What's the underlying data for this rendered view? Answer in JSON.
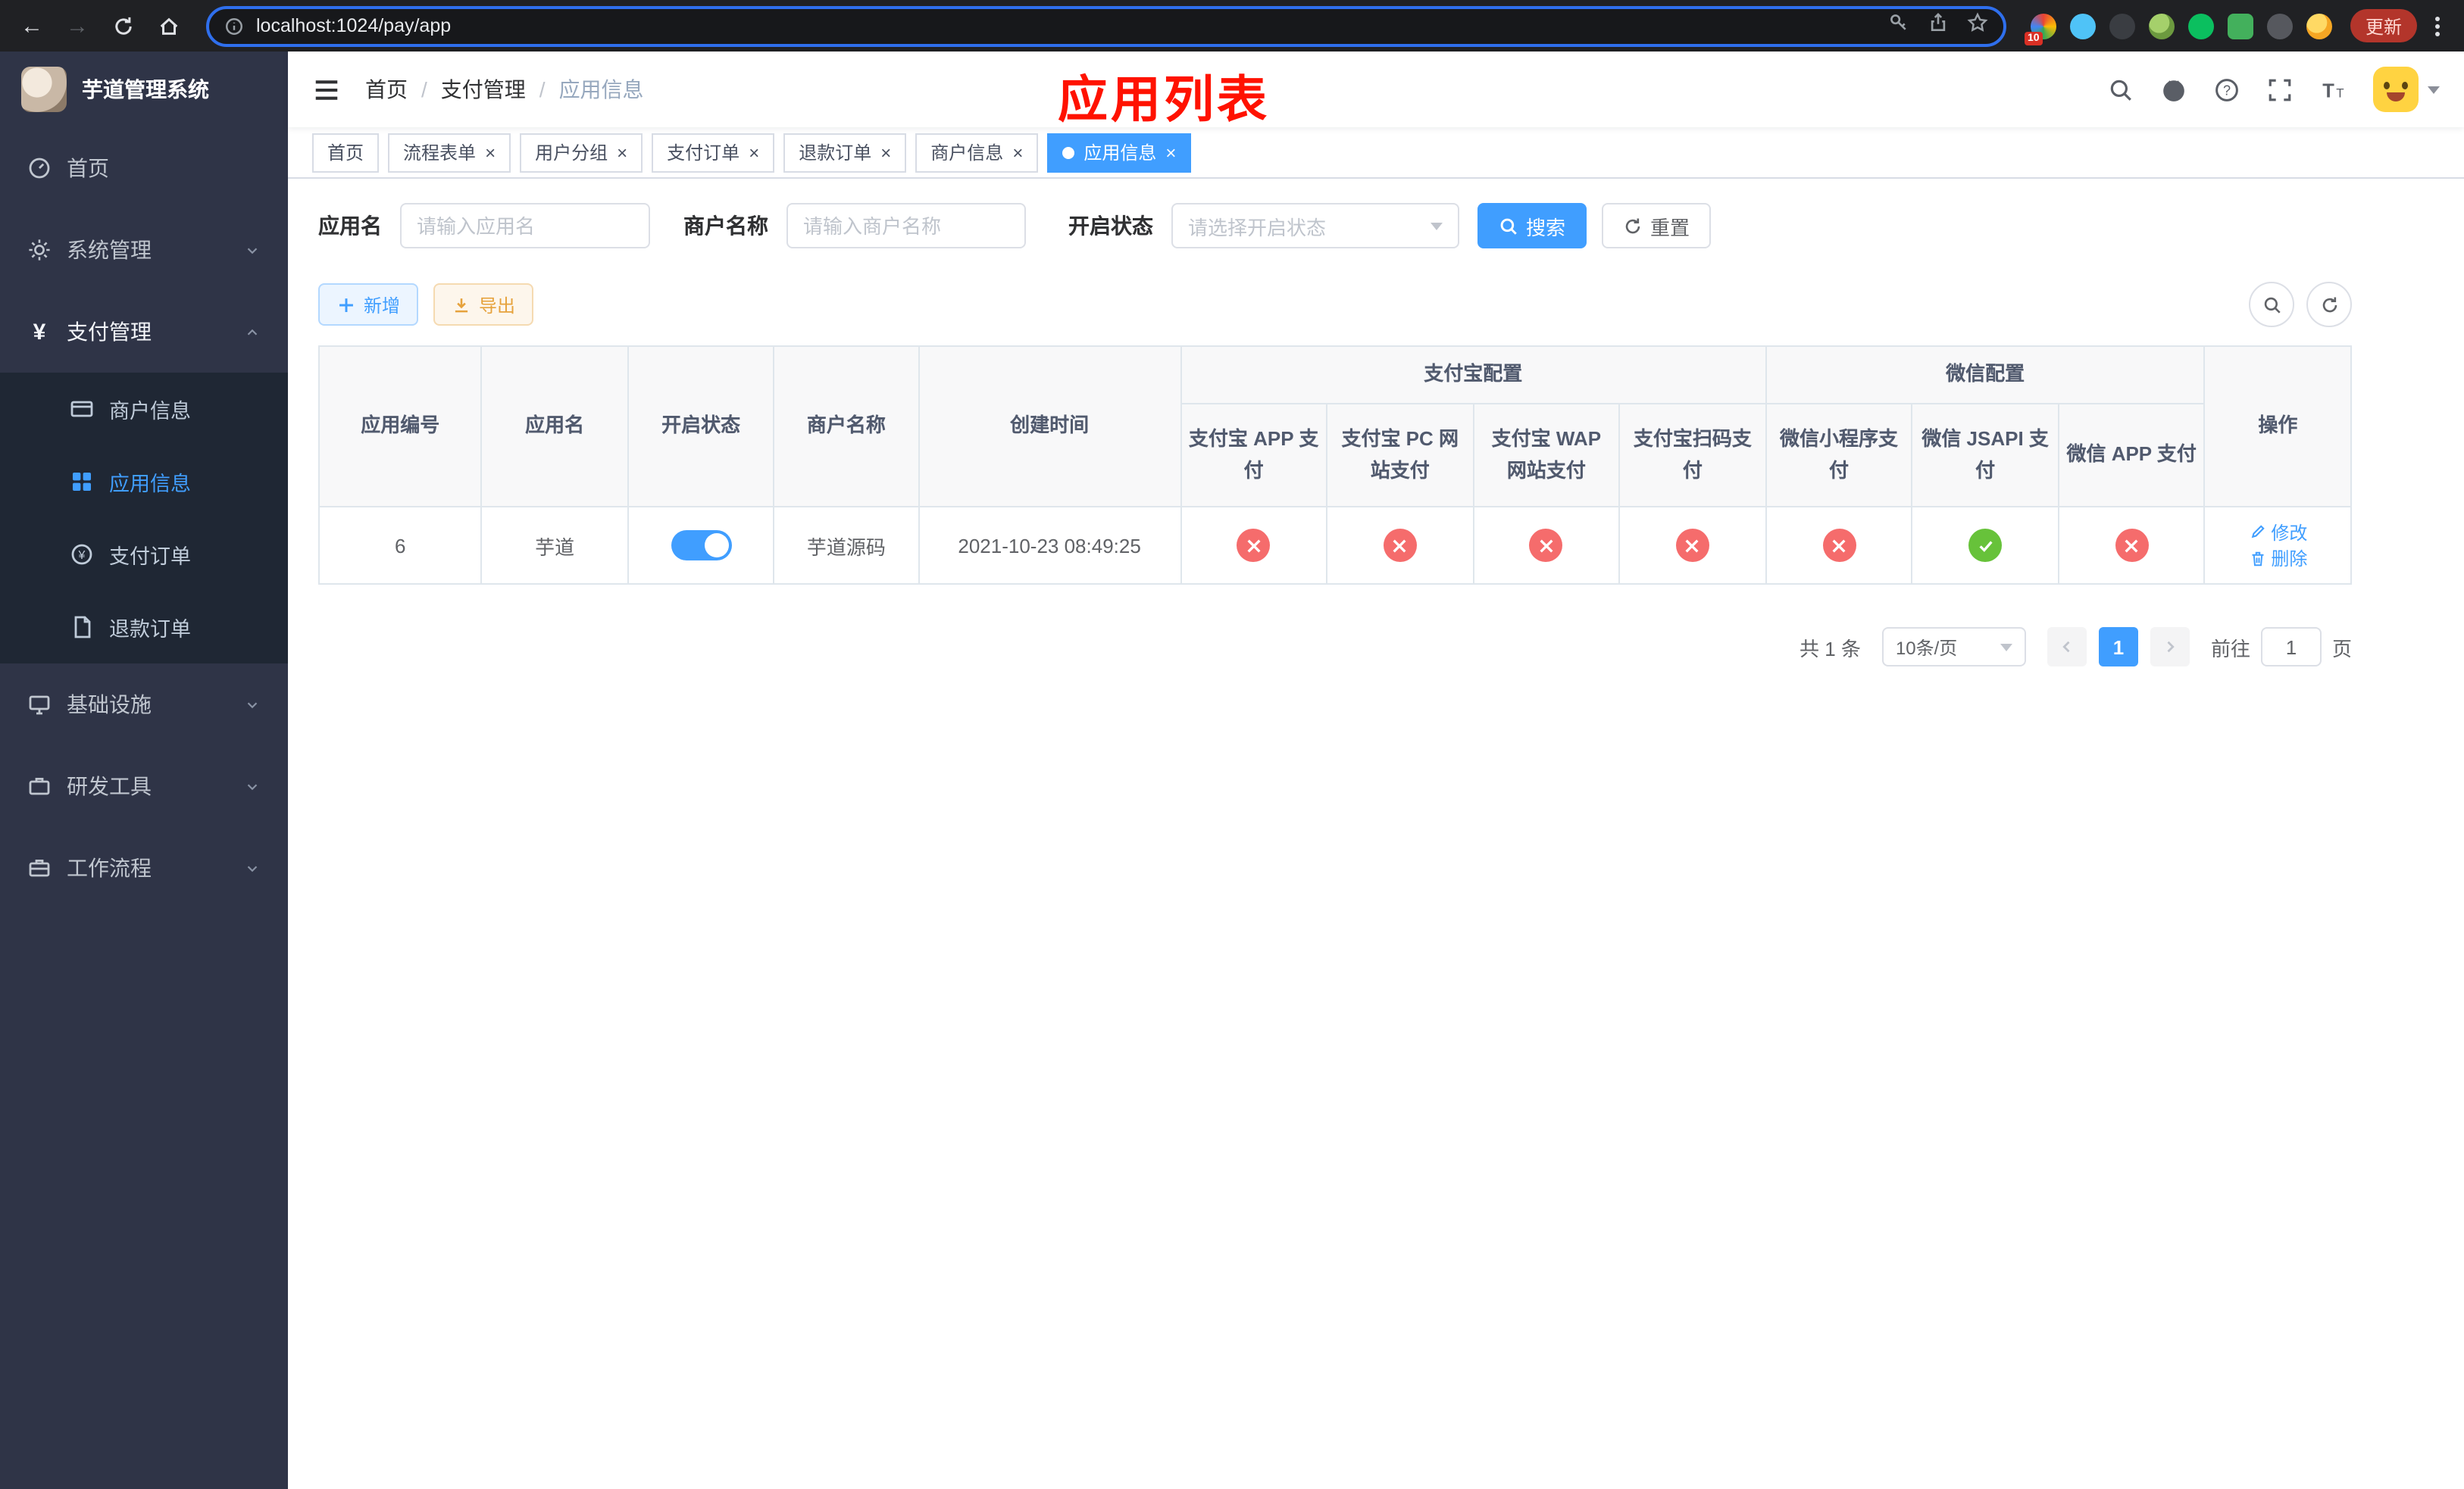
{
  "theme": {
    "primary": "#409eff",
    "success": "#67c23a",
    "danger": "#f56c6c",
    "warning": "#e6a23c",
    "sidebar_bg": "#2f3447",
    "annotation_red": "#ff1200"
  },
  "browser": {
    "url": "localhost:1024/pay/app",
    "update_label": "更新",
    "extension_badge": "10"
  },
  "sidebar": {
    "title": "芋道管理系统",
    "items": [
      {
        "label": "首页"
      },
      {
        "label": "系统管理"
      },
      {
        "label": "支付管理"
      },
      {
        "label": "基础设施"
      },
      {
        "label": "研发工具"
      },
      {
        "label": "工作流程"
      }
    ],
    "payment_children": [
      {
        "label": "商户信息"
      },
      {
        "label": "应用信息",
        "active": true
      },
      {
        "label": "支付订单"
      },
      {
        "label": "退款订单"
      }
    ]
  },
  "header": {
    "breadcrumb": [
      "首页",
      "支付管理",
      "应用信息"
    ],
    "annotation": "应用列表"
  },
  "tabs": [
    {
      "label": "首页",
      "closable": false,
      "active": false
    },
    {
      "label": "流程表单",
      "closable": true,
      "active": false
    },
    {
      "label": "用户分组",
      "closable": true,
      "active": false
    },
    {
      "label": "支付订单",
      "closable": true,
      "active": false
    },
    {
      "label": "退款订单",
      "closable": true,
      "active": false
    },
    {
      "label": "商户信息",
      "closable": true,
      "active": false
    },
    {
      "label": "应用信息",
      "closable": true,
      "active": true
    }
  ],
  "filters": {
    "app_name_label": "应用名",
    "app_name_placeholder": "请输入应用名",
    "app_name_value": "",
    "merchant_label": "商户名称",
    "merchant_placeholder": "请输入商户名称",
    "merchant_value": "",
    "status_label": "开启状态",
    "status_placeholder": "请选择开启状态",
    "search_label": "搜索",
    "reset_label": "重置"
  },
  "toolbar": {
    "add_label": "新增",
    "export_label": "导出"
  },
  "table": {
    "group_headers": {
      "alipay": "支付宝配置",
      "wechat": "微信配置"
    },
    "columns": [
      "应用编号",
      "应用名",
      "开启状态",
      "商户名称",
      "创建时间",
      "支付宝 APP 支付",
      "支付宝 PC 网站支付",
      "支付宝 WAP 网站支付",
      "支付宝扫码支付",
      "微信小程序支付",
      "微信 JSAPI 支付",
      "微信 APP 支付",
      "操作"
    ],
    "row": {
      "app_id": "6",
      "app_name": "芋道",
      "status_on": true,
      "merchant_name": "芋道源码",
      "created_at": "2021-10-23 08:49:25",
      "configs": [
        "x",
        "x",
        "x",
        "x",
        "x",
        "check",
        "x"
      ],
      "edit_label": "修改",
      "delete_label": "删除"
    }
  },
  "pagination": {
    "total_text": "共 1 条",
    "page_size": "10条/页",
    "current_page": "1",
    "goto_label": "前往",
    "goto_value": "1",
    "page_unit": "页"
  }
}
